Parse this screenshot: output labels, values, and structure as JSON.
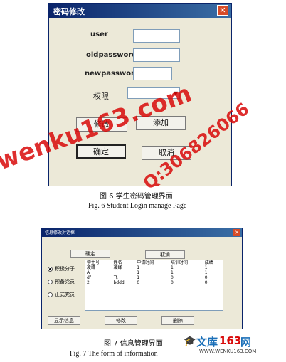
{
  "fig6": {
    "dialog": {
      "title": "密码修改",
      "labels": {
        "user": "user",
        "old": "oldpassword",
        "new": "newpassword",
        "permission": "权限"
      },
      "buttons": {
        "modify": "修改",
        "add": "添加",
        "confirm": "确定",
        "cancel": "取消"
      }
    },
    "caption_cn": "图 6   学生密码管理界面",
    "caption_en": "Fig. 6     Student Login manage Page"
  },
  "fig7": {
    "dialog": {
      "title": "信息修改对话框",
      "buttons": {
        "confirm": "确定",
        "cancel": "取消",
        "show": "显示信息",
        "modify": "修改",
        "delete": "删除"
      },
      "radios": [
        "积极分子",
        "预备党员",
        "正式党员"
      ],
      "table": {
        "headers": [
          "学生号",
          "姓名",
          "申请时间",
          "培训时间",
          "成绩"
        ],
        "rows": [
          [
            "凌峰",
            "凌峰",
            "1",
            "1",
            "1"
          ],
          [
            "A",
            "一",
            "1",
            "1",
            "1"
          ],
          [
            "df",
            "飞",
            "1",
            "0",
            "0"
          ],
          [
            "2",
            "bddd",
            "0",
            "0",
            "0"
          ]
        ]
      }
    },
    "caption_cn": "图 7   信息管理界面",
    "caption_en": "Fig. 7     The form of information"
  },
  "watermarks": {
    "main": "wenku163.com",
    "phone": "Q:306826066",
    "site_cn": "文库",
    "site_num": "163",
    "site_net": "网",
    "site_url": "WWW.WENKU163.COM"
  },
  "colors": {
    "titlebar": "#0a246a",
    "dialog_bg": "#ece9d8",
    "watermark": "#d90a0a",
    "close": "#d64b28"
  }
}
